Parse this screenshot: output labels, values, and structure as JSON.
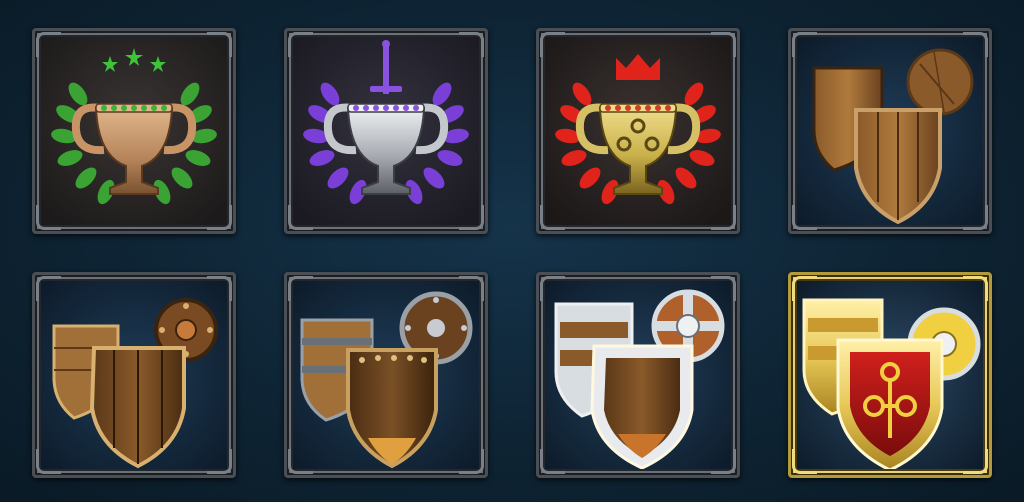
{
  "icon_grid": {
    "rows": 2,
    "columns": 4,
    "tiles": [
      {
        "id": "trophy-bronze",
        "kind": "trophy",
        "icon": "bronze-trophy-icon",
        "cup_color": "#b5835a",
        "laurel_color": "#3aa334",
        "topper": "stars",
        "topper_color": "#3ec43a",
        "gem_color": "#3ab53a"
      },
      {
        "id": "trophy-silver",
        "kind": "trophy",
        "icon": "silver-trophy-icon",
        "cup_color": "#b0b4ba",
        "laurel_color": "#7a3fd6",
        "topper": "sword",
        "topper_color": "#8a52e0",
        "gem_color": "#8a52e0"
      },
      {
        "id": "trophy-gold",
        "kind": "trophy",
        "icon": "gold-trophy-icon",
        "cup_color": "#c9b04a",
        "laurel_color": "#e0241c",
        "topper": "crown",
        "topper_color": "#e0241c",
        "gem_color": "#d43a2a"
      },
      {
        "id": "shields-wooden",
        "kind": "shields",
        "icon": "wooden-shields-icon",
        "tier": "wood"
      },
      {
        "id": "shields-bronze-studded",
        "kind": "shields",
        "icon": "studded-shields-icon",
        "tier": "bronze"
      },
      {
        "id": "shields-iron-banded",
        "kind": "shields",
        "icon": "banded-shields-icon",
        "tier": "iron"
      },
      {
        "id": "shields-steel",
        "kind": "shields",
        "icon": "steel-shields-icon",
        "tier": "steel"
      },
      {
        "id": "shields-golden",
        "kind": "shields",
        "icon": "golden-shields-icon",
        "tier": "gold"
      }
    ]
  }
}
